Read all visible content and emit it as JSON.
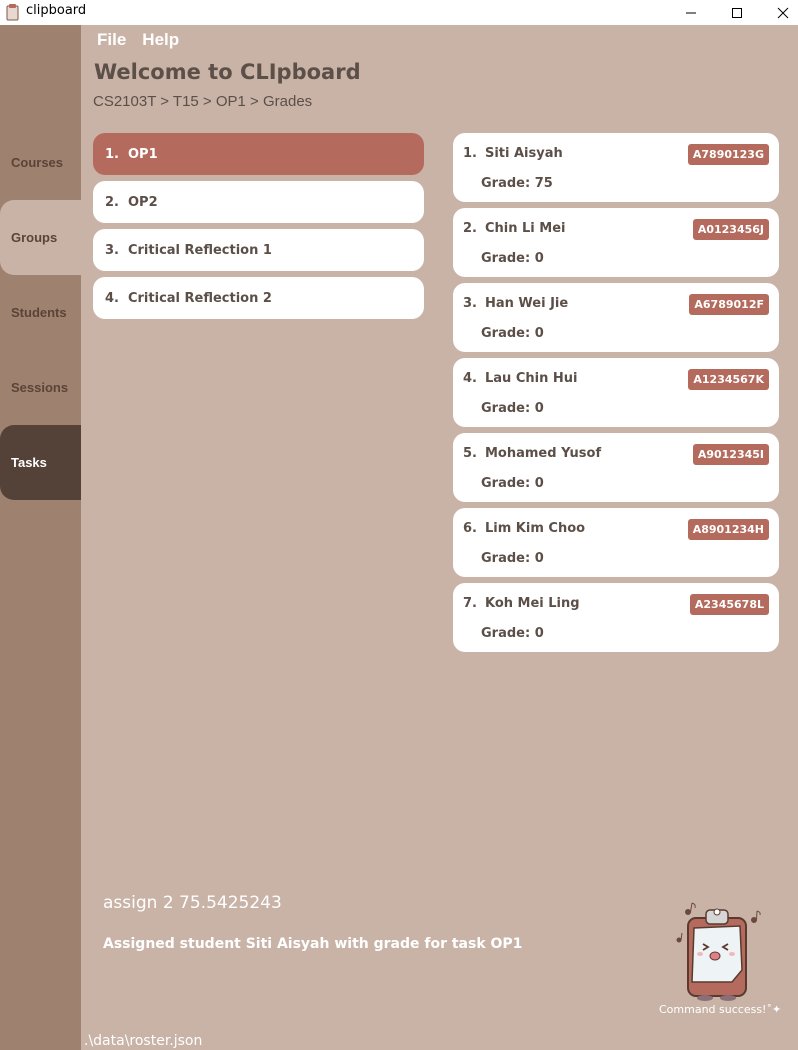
{
  "window": {
    "title": "clipboard"
  },
  "menu": {
    "file": "File",
    "help": "Help"
  },
  "header": {
    "welcome": "Welcome to CLIpboard",
    "breadcrumb": "CS2103T > T15 > OP1 > Grades"
  },
  "sidebar": {
    "items": [
      {
        "label": "Courses"
      },
      {
        "label": "Groups"
      },
      {
        "label": "Students"
      },
      {
        "label": "Sessions"
      },
      {
        "label": "Tasks"
      }
    ]
  },
  "tasks": [
    {
      "num": "1.",
      "name": "OP1"
    },
    {
      "num": "2.",
      "name": "OP2"
    },
    {
      "num": "3.",
      "name": "Critical Reflection 1"
    },
    {
      "num": "4.",
      "name": "Critical Reflection 2"
    }
  ],
  "students": [
    {
      "num": "1.",
      "name": "Siti Aisyah",
      "id": "A7890123G",
      "grade": "Grade: 75"
    },
    {
      "num": "2.",
      "name": "Chin Li Mei",
      "id": "A0123456J",
      "grade": "Grade: 0"
    },
    {
      "num": "3.",
      "name": "Han Wei Jie",
      "id": "A6789012F",
      "grade": "Grade: 0"
    },
    {
      "num": "4.",
      "name": "Lau Chin Hui",
      "id": "A1234567K",
      "grade": "Grade: 0"
    },
    {
      "num": "5.",
      "name": "Mohamed Yusof",
      "id": "A9012345I",
      "grade": "Grade: 0"
    },
    {
      "num": "6.",
      "name": "Lim Kim Choo",
      "id": "A8901234H",
      "grade": "Grade: 0"
    },
    {
      "num": "7.",
      "name": "Koh Mei Ling",
      "id": "A2345678L",
      "grade": "Grade: 0"
    }
  ],
  "command": {
    "input": "assign 2 75.5425243",
    "result": "Assigned student Siti Aisyah with grade for task OP1",
    "status": "Command success!˚✦"
  },
  "statusbar": {
    "path": ".\\data\\roster.json"
  },
  "colors": {
    "background": "#c9b3a7",
    "sidebar": "#9f8170",
    "accent": "#b46b5e",
    "active_tab_dark": "#544238"
  }
}
